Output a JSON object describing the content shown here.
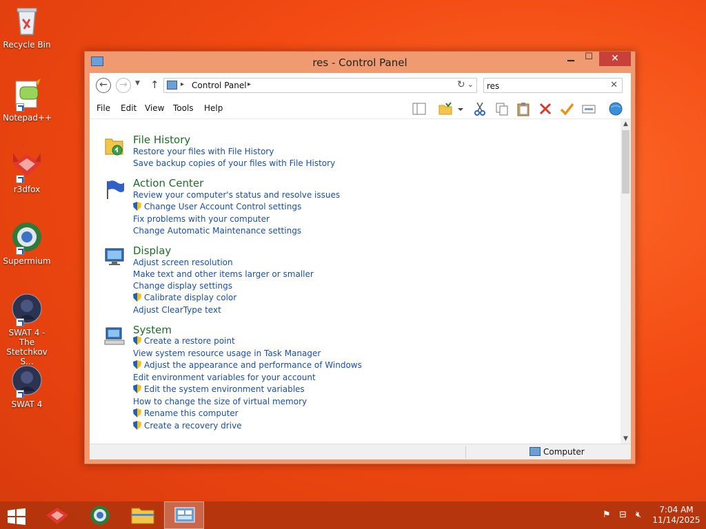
{
  "desktop": {
    "icons": [
      {
        "label": "Recycle Bin"
      },
      {
        "label": "Notepad++"
      },
      {
        "label": "r3dfox"
      },
      {
        "label": "Supermium"
      },
      {
        "label": "SWAT 4 - The Stetchkov S..."
      },
      {
        "label": "SWAT 4"
      }
    ]
  },
  "window": {
    "title": "res - Control Panel",
    "address": {
      "crumb": "Control Panel"
    },
    "search": {
      "value": "res"
    },
    "menu": [
      "File",
      "Edit",
      "View",
      "Tools",
      "Help"
    ],
    "sections": [
      {
        "title": "File History",
        "links": [
          {
            "text": "Restore your files with File History",
            "shield": false
          },
          {
            "text": "Save backup copies of your files with File History",
            "shield": false
          }
        ]
      },
      {
        "title": "Action Center",
        "links": [
          {
            "text": "Review your computer's status and resolve issues",
            "shield": false
          },
          {
            "text": "Change User Account Control settings",
            "shield": true
          },
          {
            "text": "Fix problems with your computer",
            "shield": false
          },
          {
            "text": "Change Automatic Maintenance settings",
            "shield": false
          }
        ]
      },
      {
        "title": "Display",
        "links": [
          {
            "text": "Adjust screen resolution",
            "shield": false
          },
          {
            "text": "Make text and other items larger or smaller",
            "shield": false
          },
          {
            "text": "Change display settings",
            "shield": false
          },
          {
            "text": "Calibrate display color",
            "shield": true
          },
          {
            "text": "Adjust ClearType text",
            "shield": false
          }
        ]
      },
      {
        "title": "System",
        "links": [
          {
            "text": "Create a restore point",
            "shield": true
          },
          {
            "text": "View system resource usage in Task Manager",
            "shield": false
          },
          {
            "text": "Adjust the appearance and performance of Windows",
            "shield": true
          },
          {
            "text": "Edit environment variables for your account",
            "shield": false
          },
          {
            "text": "Edit the system environment variables",
            "shield": true
          },
          {
            "text": "How to change the size of virtual memory",
            "shield": false
          },
          {
            "text": "Rename this computer",
            "shield": true
          },
          {
            "text": "Create a recovery drive",
            "shield": true
          }
        ]
      }
    ],
    "status": {
      "text": "Computer"
    }
  },
  "taskbar": {
    "clock_time": "7:04 AM",
    "clock_date": "11/14/2025"
  },
  "colors": {
    "section_title": "#1e6b29",
    "link": "#1a4fa3",
    "close_button": "#c7403a",
    "window_frame": "#f09a72"
  }
}
